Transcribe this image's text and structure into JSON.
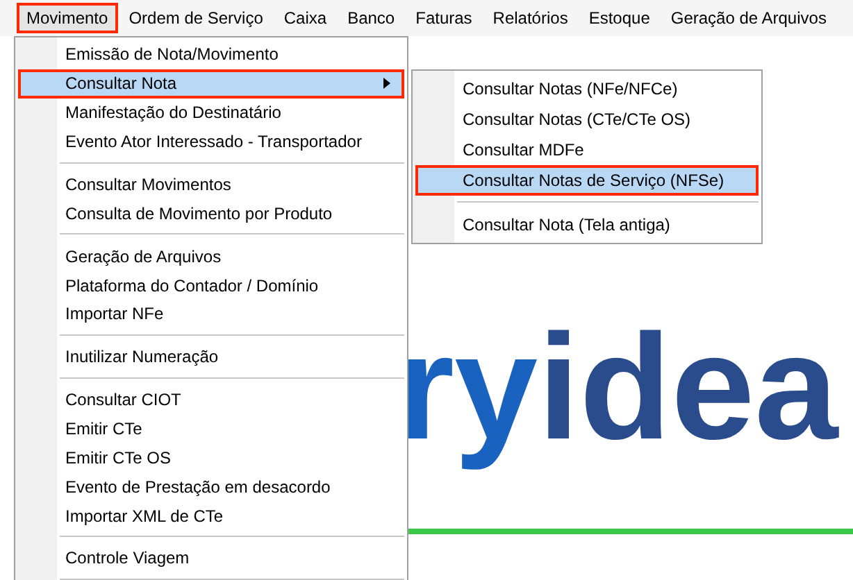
{
  "menubar": [
    {
      "label": "Movimento",
      "selected": true,
      "annotated": true
    },
    {
      "label": "Ordem de Serviço",
      "selected": false,
      "annotated": false
    },
    {
      "label": "Caixa",
      "selected": false,
      "annotated": false
    },
    {
      "label": "Banco",
      "selected": false,
      "annotated": false
    },
    {
      "label": "Faturas",
      "selected": false,
      "annotated": false
    },
    {
      "label": "Relatórios",
      "selected": false,
      "annotated": false
    },
    {
      "label": "Estoque",
      "selected": false,
      "annotated": false
    },
    {
      "label": "Geração de Arquivos",
      "selected": false,
      "annotated": false
    }
  ],
  "logo": {
    "prefix": "ry",
    "main": "idea"
  },
  "menu": {
    "items": [
      {
        "kind": "item",
        "label": "Emissão de Nota/Movimento",
        "selected": false,
        "annotated": false,
        "has_submenu": false
      },
      {
        "kind": "item",
        "label": "Consultar Nota",
        "selected": true,
        "annotated": true,
        "has_submenu": true
      },
      {
        "kind": "item",
        "label": "Manifestação do Destinatário",
        "selected": false,
        "annotated": false,
        "has_submenu": false
      },
      {
        "kind": "item",
        "label": "Evento Ator Interessado - Transportador",
        "selected": false,
        "annotated": false,
        "has_submenu": false
      },
      {
        "kind": "separator"
      },
      {
        "kind": "item",
        "label": "Consultar Movimentos",
        "selected": false,
        "annotated": false,
        "has_submenu": false
      },
      {
        "kind": "item",
        "label": "Consulta de Movimento por Produto",
        "selected": false,
        "annotated": false,
        "has_submenu": false
      },
      {
        "kind": "separator"
      },
      {
        "kind": "item",
        "label": "Geração de Arquivos",
        "selected": false,
        "annotated": false,
        "has_submenu": false
      },
      {
        "kind": "item",
        "label": "Plataforma do Contador / Domínio",
        "selected": false,
        "annotated": false,
        "has_submenu": false
      },
      {
        "kind": "item",
        "label": "Importar NFe",
        "selected": false,
        "annotated": false,
        "has_submenu": false
      },
      {
        "kind": "separator"
      },
      {
        "kind": "item",
        "label": "Inutilizar Numeração",
        "selected": false,
        "annotated": false,
        "has_submenu": false
      },
      {
        "kind": "separator"
      },
      {
        "kind": "item",
        "label": "Consultar CIOT",
        "selected": false,
        "annotated": false,
        "has_submenu": false
      },
      {
        "kind": "item",
        "label": "Emitir CTe",
        "selected": false,
        "annotated": false,
        "has_submenu": false
      },
      {
        "kind": "item",
        "label": "Emitir CTe OS",
        "selected": false,
        "annotated": false,
        "has_submenu": false
      },
      {
        "kind": "item",
        "label": "Evento de Prestação em desacordo",
        "selected": false,
        "annotated": false,
        "has_submenu": false
      },
      {
        "kind": "item",
        "label": "Importar XML de CTe",
        "selected": false,
        "annotated": false,
        "has_submenu": false
      },
      {
        "kind": "separator"
      },
      {
        "kind": "item",
        "label": "Controle Viagem",
        "selected": false,
        "annotated": false,
        "has_submenu": false
      },
      {
        "kind": "separator"
      }
    ]
  },
  "submenu": {
    "items": [
      {
        "kind": "item",
        "label": "Consultar Notas (NFe/NFCe)",
        "selected": false,
        "annotated": false,
        "has_submenu": false
      },
      {
        "kind": "item",
        "label": "Consultar Notas (CTe/CTe OS)",
        "selected": false,
        "annotated": false,
        "has_submenu": false
      },
      {
        "kind": "item",
        "label": "Consultar MDFe",
        "selected": false,
        "annotated": false,
        "has_submenu": false
      },
      {
        "kind": "item",
        "label": "Consultar Notas de Serviço (NFSe)",
        "selected": true,
        "annotated": true,
        "has_submenu": false
      },
      {
        "kind": "separator"
      },
      {
        "kind": "item",
        "label": "Consultar Nota (Tela antiga)",
        "selected": false,
        "annotated": false,
        "has_submenu": false
      }
    ]
  }
}
